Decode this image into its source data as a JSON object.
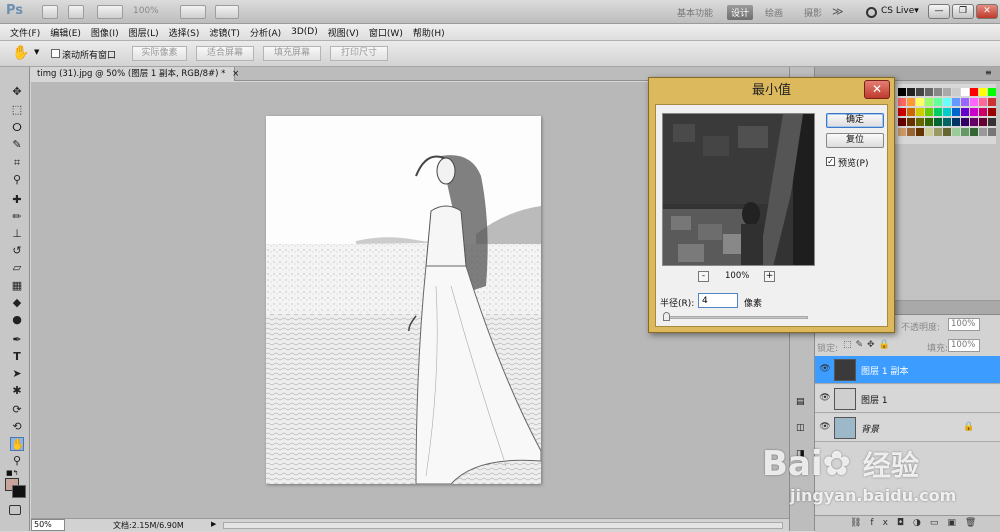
{
  "app": {
    "logo": "Ps",
    "zoom_indicator": "100%",
    "workspaces": [
      {
        "label": "基本功能",
        "active": false
      },
      {
        "label": "设计",
        "active": true
      },
      {
        "label": "绘画",
        "active": false
      },
      {
        "label": "摄影",
        "active": false
      }
    ],
    "more": "≫",
    "cs_live": "CS Live▾",
    "win_minimize": "—",
    "win_restore": "❐",
    "win_close": "✕"
  },
  "menu": [
    "文件(F)",
    "编辑(E)",
    "图像(I)",
    "图层(L)",
    "选择(S)",
    "滤镜(T)",
    "分析(A)",
    "3D(D)",
    "视图(V)",
    "窗口(W)",
    "帮助(H)"
  ],
  "options": {
    "scroll_all": "滚动所有窗口",
    "buttons": [
      "实际像素",
      "适合屏幕",
      "填充屏幕",
      "打印尺寸"
    ]
  },
  "document": {
    "tab_title": "timg (31).jpg @ 50% (图层 1 副本, RGB/8#) *",
    "tab_close": "×",
    "status_zoom": "50%",
    "status_doc": "文档:2.15M/6.90M"
  },
  "dialog": {
    "title": "最小值",
    "ok": "确定",
    "reset": "复位",
    "preview_label": "预览(P)",
    "preview_checked": true,
    "zoom_minus": "-",
    "zoom_plus": "+",
    "zoom_value": "100%",
    "radius_label": "半径(R):",
    "radius_value": "4",
    "radius_unit": "像素"
  },
  "layers": {
    "lock_label": "锁定:",
    "opacity_label": "不透明度:",
    "opacity_value": "100%",
    "fill_label": "填充:",
    "fill_value": "100%",
    "items": [
      {
        "name": "图层 1 副本",
        "selected": true
      },
      {
        "name": "图层 1",
        "selected": false
      },
      {
        "name": "背景",
        "selected": false
      }
    ]
  },
  "watermark": {
    "brand": "Bai",
    "brand_suffix": "经验",
    "url": "jingyan.baidu.com"
  },
  "colors": {
    "selection": "#3d9cff",
    "dialog_frame": "#ddb95d",
    "close_red": "#c8473a"
  }
}
